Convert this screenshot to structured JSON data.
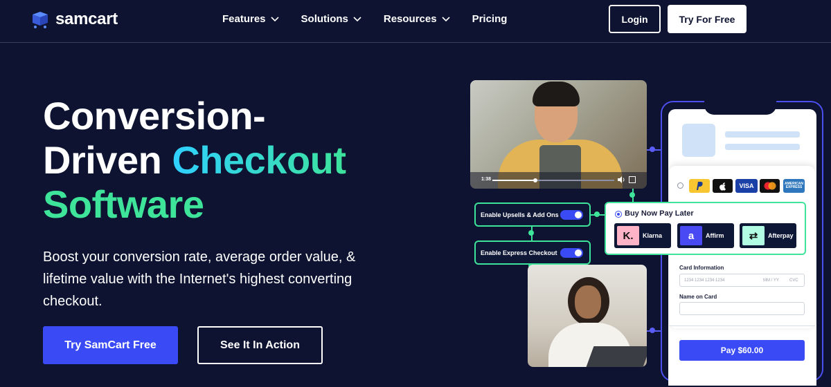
{
  "brand": {
    "name": "samcart",
    "accent": "#3a4bf5",
    "highlight": "#3ee49a",
    "background": "#0d1330"
  },
  "nav": {
    "items": [
      {
        "label": "Features",
        "has_dropdown": true
      },
      {
        "label": "Solutions",
        "has_dropdown": true
      },
      {
        "label": "Resources",
        "has_dropdown": true
      },
      {
        "label": "Pricing",
        "has_dropdown": false
      }
    ],
    "login_label": "Login",
    "try_label": "Try For Free"
  },
  "hero": {
    "title_line1": "Conversion-",
    "title_line2a": "Driven ",
    "title_line2b": "Checkout",
    "title_line3": "Software",
    "subtitle": "Boost your conversion rate, average order value, & lifetime value with the Internet's highest converting checkout.",
    "cta_primary": "Try SamCart Free",
    "cta_secondary": "See It In Action"
  },
  "visual": {
    "video": {
      "time": "1:38",
      "progress": 0.35
    },
    "toggles": [
      {
        "label": "Enable Upsells & Add Ons",
        "enabled": true
      },
      {
        "label": "Enable Express Checkout",
        "enabled": true
      }
    ],
    "payment_methods": [
      "paypal-icon",
      "apple-pay-icon",
      "visa-icon",
      "mastercard-icon",
      "amex-icon"
    ],
    "payment_labels": {
      "visa": "VISA",
      "amex": "AMERICAN EXPRESS"
    },
    "bnpl": {
      "title": "Buy Now Pay Later",
      "providers": [
        {
          "name": "Klarna",
          "mark": "K."
        },
        {
          "name": "Affirm",
          "mark": "a"
        },
        {
          "name": "Afterpay",
          "mark": "⇄"
        }
      ]
    },
    "card_form": {
      "card_label": "Card Information",
      "card_placeholder": "1234 1234 1234 1234",
      "mmyy_placeholder": "MM / YY",
      "cvc_placeholder": "CVC",
      "name_label": "Name on Card",
      "name_value": ""
    },
    "pay_button": "Pay $60.00"
  }
}
